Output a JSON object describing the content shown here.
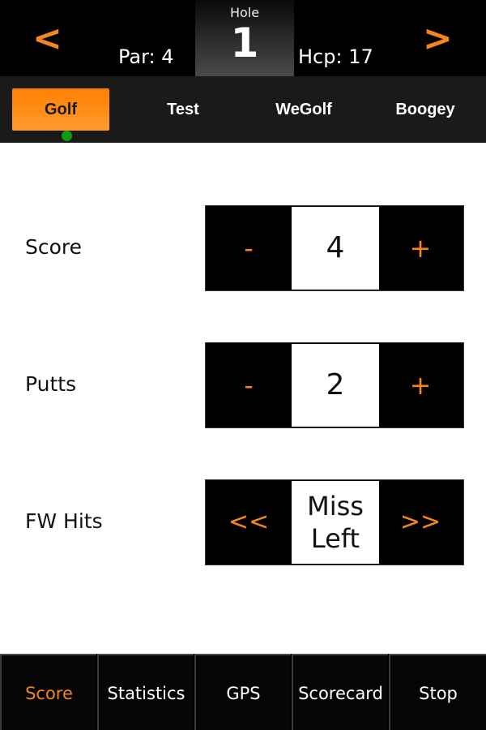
{
  "header": {
    "prev_label": "<",
    "next_label": ">",
    "hole_label": "Hole",
    "hole_number": "1",
    "par_text": "Par: 4",
    "hcp_text": "Hcp: 17"
  },
  "players": {
    "tabs": [
      {
        "label": "Golf",
        "active": true
      },
      {
        "label": "Test",
        "active": false
      },
      {
        "label": "WeGolf",
        "active": false
      },
      {
        "label": "Boogey",
        "active": false
      }
    ]
  },
  "fields": {
    "score": {
      "label": "Score",
      "minus": "-",
      "value": "4",
      "plus": "+"
    },
    "putts": {
      "label": "Putts",
      "minus": "-",
      "value": "2",
      "plus": "+"
    },
    "fw_hits": {
      "label": "FW Hits",
      "prev": "<<",
      "value_line1": "Miss",
      "value_line2": "Left",
      "next": ">>"
    }
  },
  "bottom_nav": {
    "items": [
      {
        "label": "Score",
        "active": true
      },
      {
        "label": "Statistics",
        "active": false
      },
      {
        "label": "GPS",
        "active": false
      },
      {
        "label": "Scorecard",
        "active": false
      },
      {
        "label": "Stop",
        "active": false
      }
    ]
  },
  "colors": {
    "accent": "#f5861f",
    "active_dot": "#129a12"
  }
}
